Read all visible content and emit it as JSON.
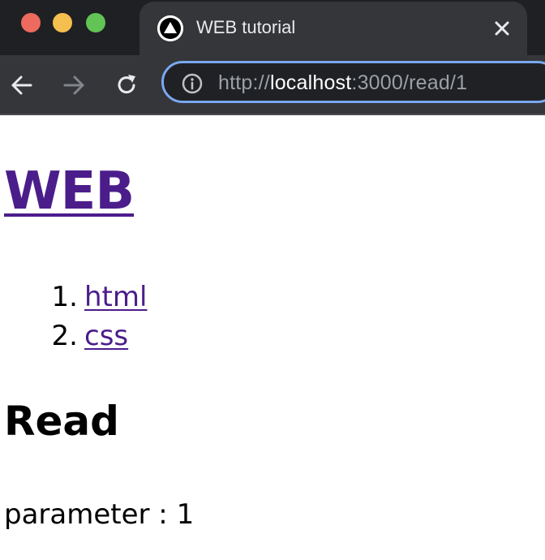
{
  "browser": {
    "tab": {
      "title": "WEB tutorial",
      "favicon": "triangle-logo-icon",
      "close_icon": "close-icon"
    },
    "toolbar": {
      "back_icon": "back-arrow-icon",
      "forward_icon": "forward-arrow-icon",
      "reload_icon": "reload-icon",
      "info_icon": "info-icon"
    },
    "address": {
      "scheme": "http://",
      "host": "localhost",
      "rest": ":3000/read/1"
    },
    "colors": {
      "titlebar": "#1f2023",
      "tab": "#35363a",
      "omnibox_border": "#7aa7f0",
      "traffic_red": "#ed6a5e",
      "traffic_yellow": "#f5bf4f",
      "traffic_green": "#61c454"
    }
  },
  "page": {
    "title": "WEB",
    "topics": [
      {
        "number": "1.",
        "label": "html"
      },
      {
        "number": "2.",
        "label": "css"
      }
    ],
    "heading": "Read",
    "parameter_text": "parameter : 1",
    "link_color": "#4b1d8b"
  }
}
